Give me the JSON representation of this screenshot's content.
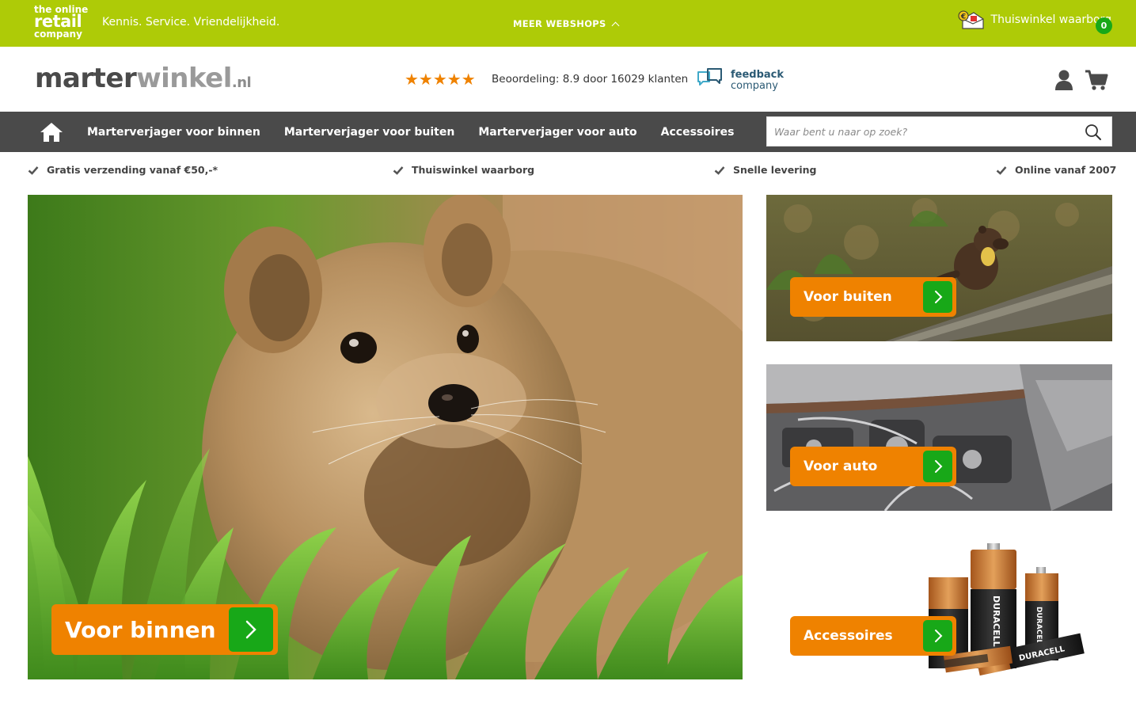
{
  "topbar": {
    "logo": {
      "line1": "the online",
      "line2": "retail",
      "line3": "company"
    },
    "tagline": "Kennis. Service. Vriendelijkheid.",
    "webshops_label": "MEER WEBSHOPS",
    "waarborg_label": "Thuiswinkel waarborg",
    "accent_color": "#aecb07"
  },
  "header": {
    "logo": {
      "part1": "marter",
      "part2": "winkel",
      "part3": ".nl"
    },
    "rating": {
      "stars": "★★★★★",
      "score": 8.9,
      "text": "Beoordeling: 8.9 door 16029 klanten"
    },
    "feedback": {
      "line1": "feedback",
      "line2": "company"
    },
    "cart_count": "0"
  },
  "nav": {
    "items": [
      {
        "label": "Marterverjager voor binnen"
      },
      {
        "label": "Marterverjager voor buiten"
      },
      {
        "label": "Marterverjager voor auto"
      },
      {
        "label": "Accessoires"
      }
    ],
    "search_placeholder": "Waar bent u naar op zoek?"
  },
  "usps": [
    {
      "label": "Gratis verzending vanaf €50,-*"
    },
    {
      "label": "Thuiswinkel waarborg"
    },
    {
      "label": "Snelle levering"
    },
    {
      "label": "Online vanaf 2007"
    }
  ],
  "hero": {
    "cta_label": "Voor binnen"
  },
  "side_banners": [
    {
      "cta_label": "Voor buiten"
    },
    {
      "cta_label": "Voor auto"
    },
    {
      "cta_label": "Accessoires"
    }
  ],
  "colors": {
    "orange": "#ef8200",
    "green": "#18a818",
    "nav_bg": "#4a4a4a"
  },
  "icons": [
    "home-icon",
    "search-icon",
    "user-icon",
    "cart-icon",
    "check-icon",
    "chevron-right-icon",
    "chevron-up-icon",
    "thuiswinkel-icon",
    "feedback-company-icon"
  ]
}
